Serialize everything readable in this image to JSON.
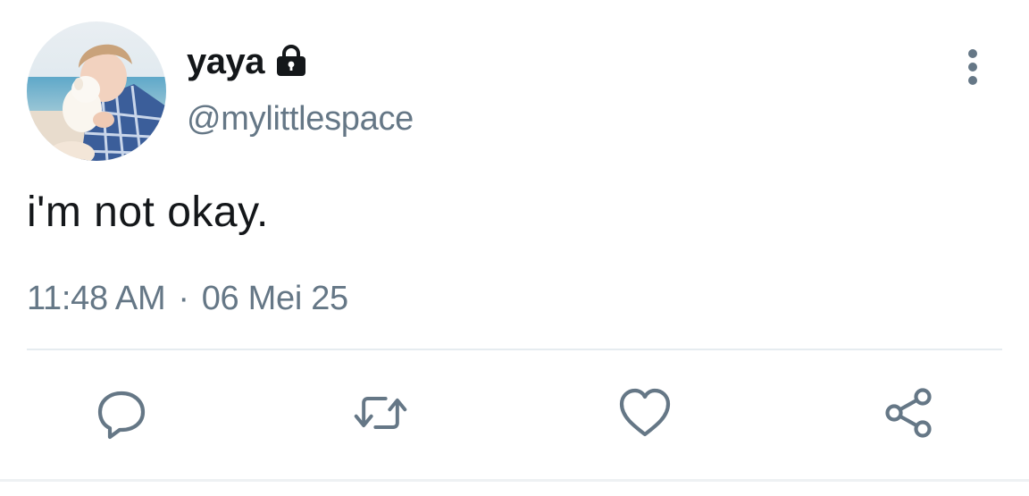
{
  "user": {
    "display_name": "yaya",
    "handle": "@mylittlespace",
    "protected_icon": "lock-icon",
    "avatar": "profile-photo"
  },
  "tweet": {
    "text": "i'm not okay.",
    "time": "11:48 AM",
    "separator": "·",
    "date": "06 Mei 25"
  },
  "actions": [
    {
      "name": "reply",
      "icon": "reply-icon"
    },
    {
      "name": "retweet",
      "icon": "retweet-icon"
    },
    {
      "name": "like",
      "icon": "heart-icon"
    },
    {
      "name": "share",
      "icon": "share-icon"
    }
  ],
  "menu": {
    "icon": "more-vertical-icon"
  },
  "colors": {
    "text": "#14171a",
    "secondary": "#657786",
    "divider": "#e6ecf0",
    "icon": "#657786"
  }
}
